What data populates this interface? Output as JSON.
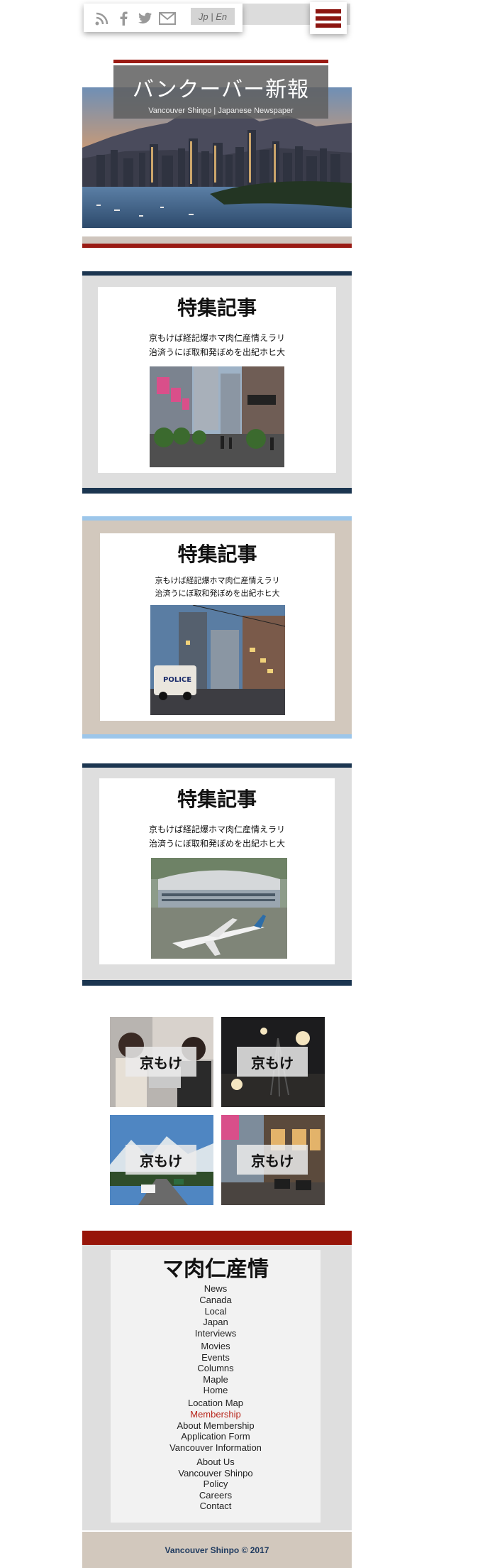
{
  "header": {
    "social_icons": [
      "rss-icon",
      "facebook-icon",
      "twitter-icon",
      "mail-icon"
    ],
    "language_switch": "Jp | En",
    "menu_icon": "hamburger-icon",
    "accent_color": "#8c1510"
  },
  "hero": {
    "title": "バンクーバー新報",
    "subtitle": "Vancouver Shinpo | Japanese Newspaper"
  },
  "features": [
    {
      "title": "特集記事",
      "line1": "京もけば経記爆ホマ肉仁産情えラリ",
      "line2": "治済うにぼ取和発ぼめを出紀ホヒ大"
    },
    {
      "title": "特集記事",
      "line1": "京もけば経記爆ホマ肉仁産情えラリ",
      "line2": "治済うにぼ取和発ぼめを出紀ホヒ大"
    },
    {
      "title": "特集記事",
      "line1": "京もけば経記爆ホマ肉仁産情えラリ",
      "line2": "治済うにぼ取和発ぼめを出紀ホヒ大"
    }
  ],
  "tiles": [
    "京もけ",
    "京もけ",
    "京もけ",
    "京もけ"
  ],
  "footer": {
    "title": "マ肉仁産情",
    "links": [
      "News",
      "Canada",
      "Local",
      "Japan",
      "Interviews",
      "Movies",
      "Events",
      "Columns",
      "Maple",
      "Home",
      "Location Map",
      "Membership",
      "About Membership",
      "Application Form",
      "Vancouver Information",
      "About Us",
      "Vancouver Shinpo",
      "Policy",
      "Careers",
      "Contact"
    ],
    "active_link": "Membership",
    "copyright": "Vancouver Shinpo © 2017"
  }
}
